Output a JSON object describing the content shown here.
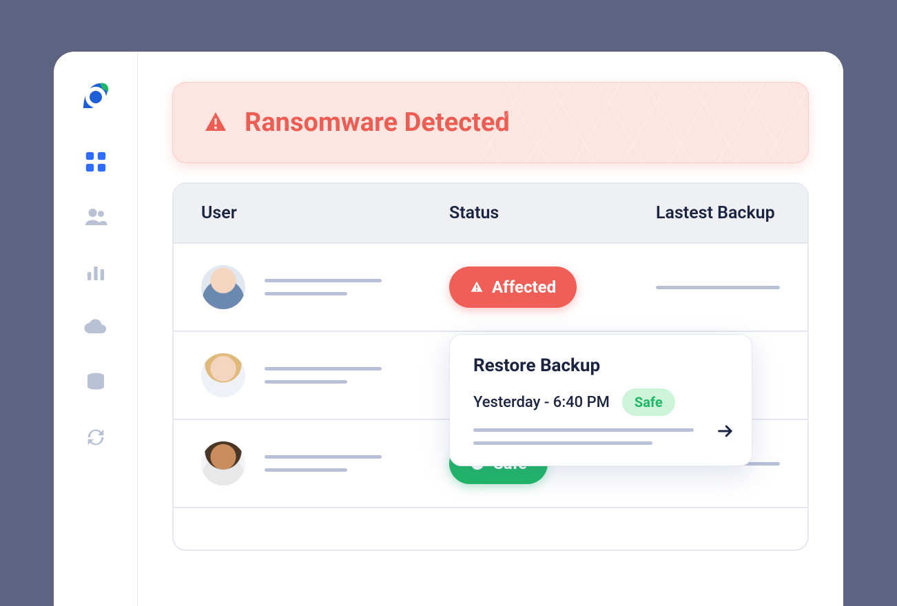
{
  "alert": {
    "title": "Ransomware Detected"
  },
  "table": {
    "headers": {
      "user": "User",
      "status": "Status",
      "backup": "Lastest Backup"
    },
    "rows": [
      {
        "status": "Affected"
      },
      {
        "status": ""
      },
      {
        "status": "Safe"
      }
    ]
  },
  "restore": {
    "title": "Restore Backup",
    "time": "Yesterday - 6:40 PM",
    "badge": "Safe"
  }
}
